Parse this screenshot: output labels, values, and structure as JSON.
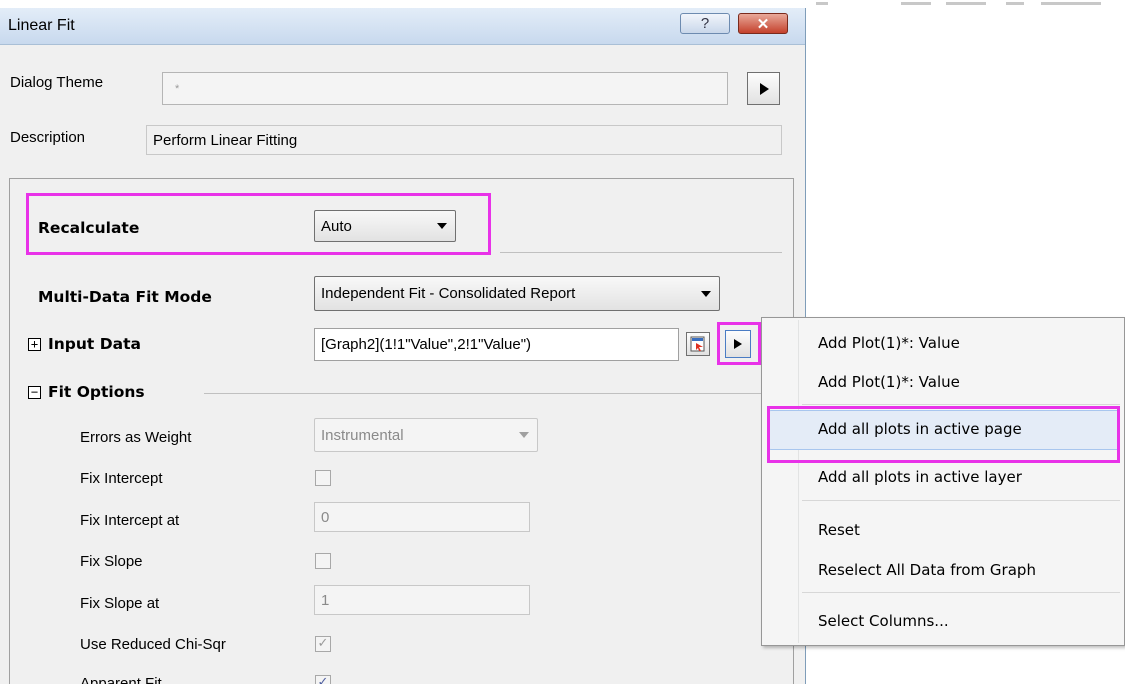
{
  "window": {
    "title": "Linear Fit",
    "help_glyph": "?",
    "close_glyph": "✕"
  },
  "header": {
    "dialog_theme_label": "Dialog Theme",
    "dialog_theme_value": "*",
    "description_label": "Description",
    "description_value": "Perform Linear Fitting"
  },
  "settings": {
    "recalculate_label": "Recalculate",
    "recalculate_value": "Auto",
    "multi_fit_label": "Multi-Data Fit Mode",
    "multi_fit_value": "Independent Fit - Consolidated Report",
    "input_data_label": "Input Data",
    "input_data_value": "[Graph2](1!1\"Value\",2!1\"Value\")",
    "fit_options_label": "Fit Options",
    "expander_plus": "+",
    "expander_minus": "−"
  },
  "fit_options": {
    "errors_label": "Errors as Weight",
    "errors_value": "Instrumental",
    "fix_intercept_label": "Fix Intercept",
    "fix_intercept_checked": false,
    "fix_intercept_at_label": "Fix Intercept at",
    "fix_intercept_at_value": "0",
    "fix_slope_label": "Fix Slope",
    "fix_slope_checked": false,
    "fix_slope_at_label": "Fix Slope at",
    "fix_slope_at_value": "1",
    "reduced_chisqr_label": "Use Reduced Chi-Sqr",
    "reduced_chisqr_checked": true,
    "apparent_fit_label": "Apparent Fit",
    "apparent_fit_checked": true,
    "check_glyph": "✓"
  },
  "context_menu": {
    "items": [
      "Add Plot(1)*: Value",
      "Add Plot(1)*: Value",
      "Add all plots in active page",
      "Add all plots in active layer",
      "Reset",
      "Reselect All Data from Graph",
      "Select Columns..."
    ],
    "highlighted_item": "Add all plots in active page"
  },
  "colors": {
    "highlight_box": "#e832e8",
    "menu_hover": "#e4ecf7",
    "window_bg": "#f0f0f0"
  },
  "icons": {
    "theme_arrow": "right-triangle-icon",
    "select_data": "select-data-from-graph-icon",
    "input_menu_arrow": "right-triangle-icon"
  }
}
